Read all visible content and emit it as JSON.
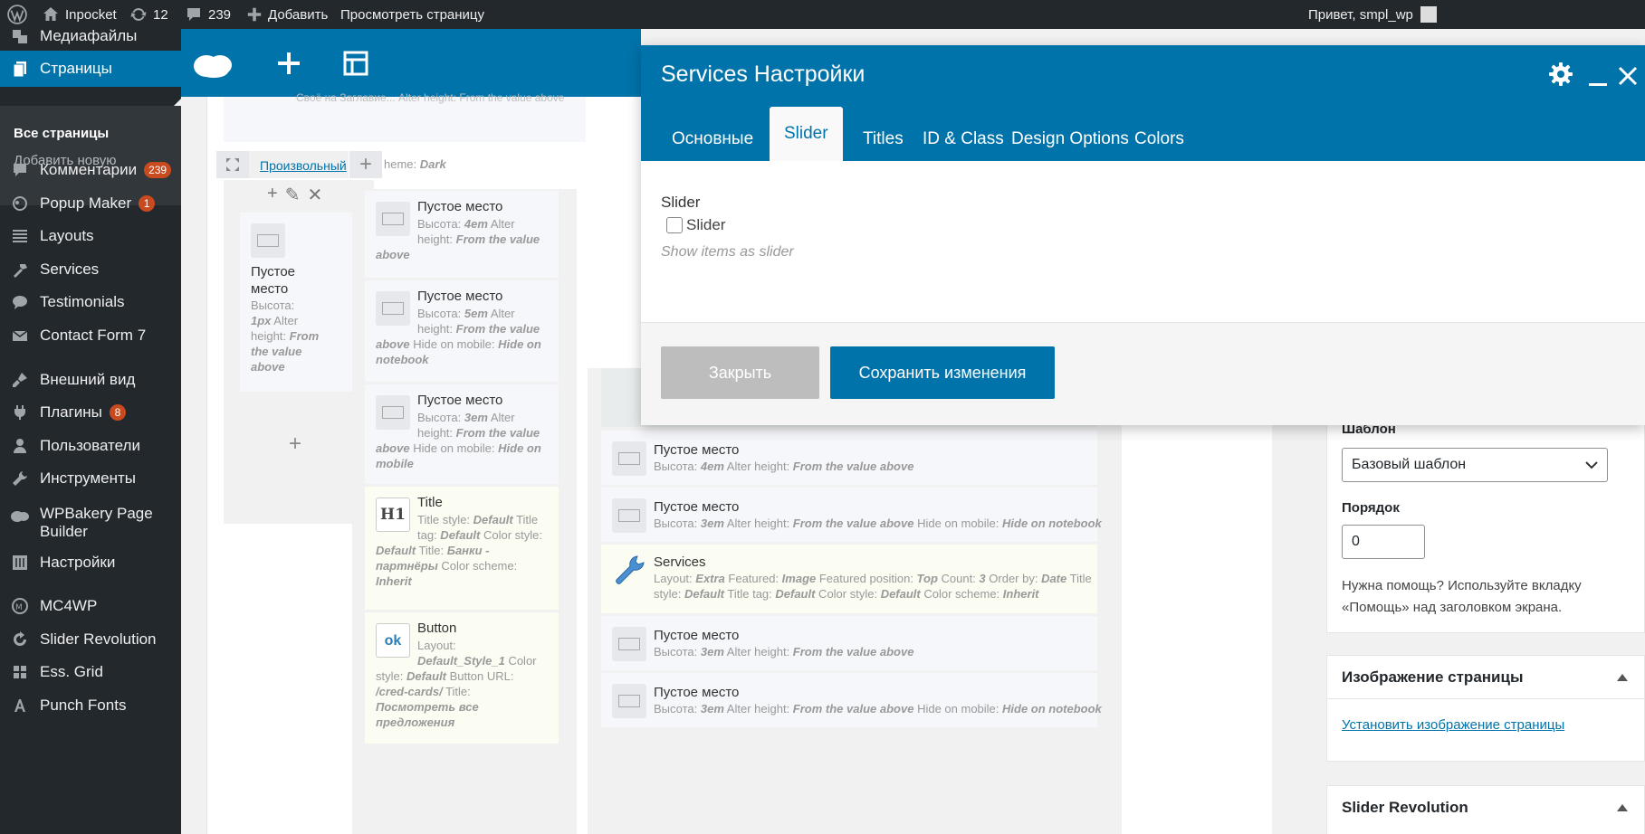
{
  "admin_bar": {
    "site_name": "Inpocket",
    "updates_count": "12",
    "comments_count": "239",
    "add_new": "Добавить",
    "view_page": "Просмотреть страницу",
    "greeting": "Привет, smpl_wp"
  },
  "admin_menu": {
    "media": "Медиафайлы",
    "pages": "Страницы",
    "submenu": {
      "all_pages": "Все страницы",
      "add_new": "Добавить новую"
    },
    "comments": "Комментарии",
    "comments_badge": "239",
    "popup_maker": "Popup Maker",
    "popup_badge": "1",
    "layouts": "Layouts",
    "services": "Services",
    "testimonials": "Testimonials",
    "contact_form": "Contact Form 7",
    "appearance": "Внешний вид",
    "plugins": "Плагины",
    "plugins_badge": "8",
    "users": "Пользователи",
    "tools": "Инструменты",
    "wpbakery_line1": "WPBakery Page",
    "wpbakery_line2": "Builder",
    "settings": "Настройки",
    "mc4wp": "MC4WP",
    "slider_revolution": "Slider Revolution",
    "ess_grid": "Ess. Grid",
    "punch_fonts": "Punch Fonts"
  },
  "builder": {
    "top_faded_text": "Своё на Заглавие... Alter height: From the value above",
    "row_custom_link": "Произвольный",
    "row_scheme_label": "heme:",
    "row_scheme_value": "Dark",
    "col1": {
      "title_line1": "Пустое",
      "title_line2": "место",
      "p1": "Высота:",
      "p2v": "1px",
      "p2": " Alter",
      "p3": "height:",
      "p3v": " From",
      "p4v": "the value",
      "p5v": "above"
    },
    "col2": [
      {
        "title": "Пустое место",
        "l1": "Высота:",
        "l1v": "4em",
        "l1b": " Alter",
        "l2": "height:",
        "l2v": "From the value",
        "l3v": "above",
        "l3": "",
        "l3w": "",
        "l4v": ""
      },
      {
        "title": "Пустое место",
        "l1": "Высота:",
        "l1v": "5em",
        "l1b": " Alter",
        "l2": "height:",
        "l2v": "From the value",
        "l3v": "above",
        "l3": " Hide on mobile:",
        "l3w": " Hide on",
        "l4v": "notebook"
      },
      {
        "title": "Пустое место",
        "l1": "Высота:",
        "l1v": "3em",
        "l1b": " Alter",
        "l2": "height:",
        "l2v": "From the value",
        "l3v": "above",
        "l3": " Hide on mobile:",
        "l3w": " Hide on",
        "l4v": "mobile"
      }
    ],
    "col2_title_el": {
      "title": "Title",
      "icon_text": "H1",
      "l1": "Title style:",
      "l1v": " Default",
      "l1b": " Title",
      "l2": "tag:",
      "l2v": " Default",
      "l2b": " Color style:",
      "l3v": "Default",
      "l3": " Title:",
      "l3w": " Банки -",
      "l4v": "партнёры",
      "l4": " Color scheme:",
      "l5v": "Inherit"
    },
    "col2_button_el": {
      "title": "Button",
      "icon_text": "ok",
      "l1": "Layout:",
      "l2v": "Default_Style_1",
      "l2": " Color",
      "l3": "style:",
      "l3v": " Default",
      "l3b": " Button URL:",
      "l4v": "/cred-cards/",
      "l4": " Title:",
      "l5v": "Посмотреть все",
      "l6v": "предложения"
    },
    "col3": [
      {
        "title": "Пустое место",
        "a": "Высота:",
        "av": " 4em",
        "b": " Alter height:",
        "bv": " From the value above",
        "c": "",
        "cv": ""
      },
      {
        "title": "Пустое место",
        "a": "Высота:",
        "av": " 3em",
        "b": " Alter height:",
        "bv": " From the value above",
        "c": " Hide on mobile:",
        "cv": " Hide on notebook"
      },
      {
        "title": "Пустое место",
        "a": "Высота:",
        "av": " 3em",
        "b": " Alter height:",
        "bv": " From the value above",
        "c": "",
        "cv": ""
      },
      {
        "title": "Пустое место",
        "a": "Высота:",
        "av": " 3em",
        "b": " Alter height:",
        "bv": " From the value above",
        "c": " Hide on mobile:",
        "cv": " Hide on notebook"
      }
    ],
    "services_el": {
      "title": "Services",
      "l1a": "Layout:",
      "l1av": " Extra",
      "l1b": " Featured:",
      "l1bv": " Image",
      "l1c": " Featured position:",
      "l1cv": " Top",
      "l1d": " Count:",
      "l1dv": " 3",
      "l1e": " Order by:",
      "l1ev": " Date",
      "l1f": " Title",
      "l2a": "style:",
      "l2av": " Default",
      "l2b": " Title tag:",
      "l2bv": " Default",
      "l2c": " Color style:",
      "l2cv": " Default",
      "l2d": " Color scheme:",
      "l2dv": " Inherit"
    }
  },
  "sidebar": {
    "template_label": "Шаблон",
    "template_value": "Базовый шаблон",
    "order_label": "Порядок",
    "order_value": "0",
    "help_line1": "Нужна помощь? Используйте вкладку",
    "help_line2": "«Помощь» над заголовком экрана.",
    "featured_title": "Изображение страницы",
    "featured_link": "Установить изображение страницы",
    "slider_rev_title": "Slider Revolution"
  },
  "modal": {
    "title": "Services Настройки",
    "tabs": [
      "Основные",
      "Slider",
      "Titles",
      "ID & Class",
      "Design Options",
      "Colors"
    ],
    "active_tab": "Slider",
    "field_label": "Slider",
    "checkbox_label": "Slider",
    "field_description": "Show items as slider",
    "close_button": "Закрыть",
    "save_button": "Сохранить изменения"
  },
  "colors": {
    "wp_dark": "#23282d",
    "wp_blue": "#0073aa",
    "badge": "#ca4a1f"
  }
}
